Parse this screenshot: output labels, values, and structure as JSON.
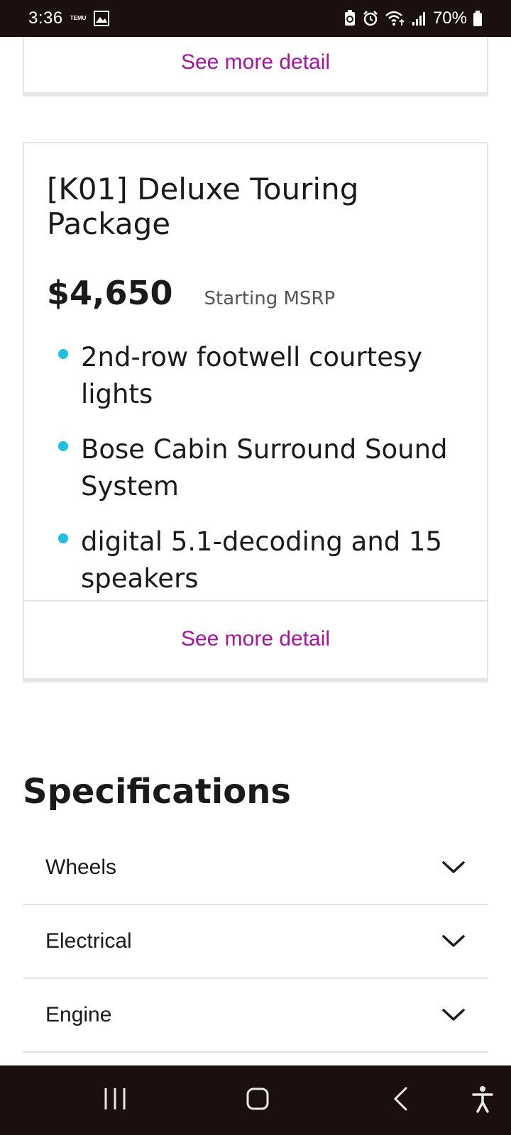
{
  "status": {
    "time": "3:36",
    "temu_label": "TEMU",
    "battery": "70%"
  },
  "top_card": {
    "see_more": "See more detail"
  },
  "package": {
    "title": "[K01] Deluxe Touring Package",
    "price": "$4,650",
    "price_label": "Starting MSRP",
    "features": [
      "2nd-row footwell courtesy lights",
      "Bose Cabin Surround Sound System",
      "digital 5.1-decoding and 15 speakers"
    ],
    "see_more": "See more detail"
  },
  "specifications": {
    "title": "Specifications",
    "items": [
      {
        "label": "Wheels"
      },
      {
        "label": "Electrical"
      },
      {
        "label": "Engine"
      }
    ]
  },
  "colors": {
    "link": "#a3169c",
    "bullet": "#1ec0e0",
    "system_bar": "#1b100d"
  },
  "icons": {
    "nav": [
      "recent-apps-icon",
      "home-icon",
      "back-icon",
      "accessibility-icon"
    ],
    "status": [
      "notification-image-icon",
      "battery-saver-icon",
      "alarm-icon",
      "wifi-icon",
      "signal-icon",
      "battery-icon"
    ]
  }
}
